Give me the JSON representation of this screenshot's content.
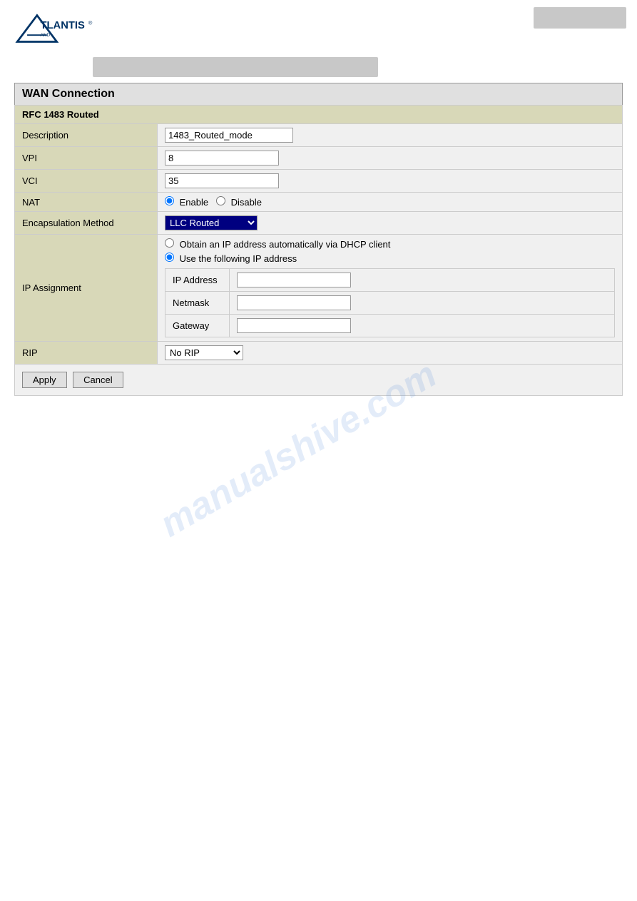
{
  "header": {
    "logo_alt": "Atlantis Land Logo",
    "top_right_label": ""
  },
  "page": {
    "section_title": "WAN Connection",
    "subheader": "RFC 1483 Routed",
    "fields": {
      "description_label": "Description",
      "description_value": "1483_Routed_mode",
      "vpi_label": "VPI",
      "vpi_value": "8",
      "vci_label": "VCI",
      "vci_value": "35",
      "nat_label": "NAT",
      "nat_enable": "Enable",
      "nat_disable": "Disable",
      "encap_label": "Encapsulation Method",
      "encap_value": "LLC Routed",
      "ip_assignment_label": "IP Assignment",
      "ip_option1": "Obtain an IP address automatically via DHCP client",
      "ip_option2": "Use the following IP address",
      "ip_address_label": "IP Address",
      "netmask_label": "Netmask",
      "gateway_label": "Gateway",
      "rip_label": "RIP",
      "rip_value": "No RIP"
    },
    "buttons": {
      "apply": "Apply",
      "cancel": "Cancel"
    },
    "watermark": "manualshive.com"
  }
}
